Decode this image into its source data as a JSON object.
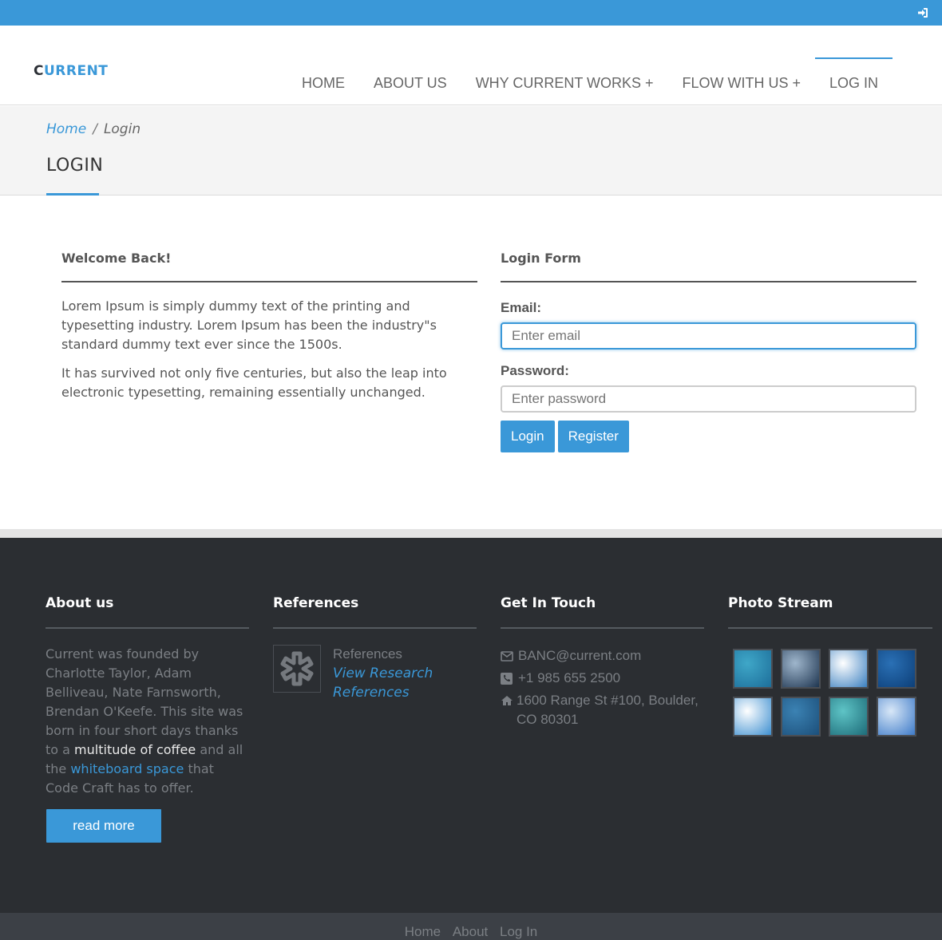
{
  "colors": {
    "accent": "#3a98d8",
    "footer_bg": "#2b2e32"
  },
  "topbar": {
    "icon": "sign-in-icon"
  },
  "brand": {
    "first_letter": "C",
    "rest": "URRENT"
  },
  "nav": {
    "home": "HOME",
    "about": "ABOUT US",
    "why": "WHY CURRENT WORKS +",
    "flow": "FLOW WITH US +",
    "login": "LOG IN"
  },
  "breadcrumb": {
    "home": "Home",
    "separator": "/",
    "current": "Login"
  },
  "page_title": "LOGIN",
  "welcome": {
    "heading": "Welcome Back!",
    "p1": "Lorem Ipsum is simply dummy text of the printing and typesetting industry. Lorem Ipsum has been the industry\"s standard dummy text ever since the 1500s.",
    "p2": "It has survived not only five centuries, but also the leap into electronic typesetting, remaining essentially unchanged."
  },
  "login_form": {
    "heading": "Login Form",
    "email_label": "Email:",
    "email_placeholder": "Enter email",
    "password_label": "Password:",
    "password_placeholder": "Enter password",
    "login_button": "Login",
    "register_button": "Register"
  },
  "footer": {
    "about": {
      "heading": "About us",
      "text_1": "Current was founded by Charlotte Taylor, Adam Belliveau, Nate Farnsworth, Brendan O'Keefe. This site was born in four short days thanks to a ",
      "highlight": "multitude of coffee",
      "text_2": " and all the ",
      "link": "whiteboard space",
      "text_3": " that Code Craft has to offer.",
      "read_more": "read more"
    },
    "references": {
      "heading": "References",
      "item_title": "References",
      "item_link": "View Research References"
    },
    "contact": {
      "heading": "Get In Touch",
      "email": "BANC@current.com",
      "phone": "+1 985 655 2500",
      "address": "1600 Range St #100, Boulder, CO 80301"
    },
    "photo_stream": {
      "heading": "Photo Stream",
      "photos": [
        {
          "color_a": "#3fa7c8",
          "color_b": "#1d6e9a"
        },
        {
          "color_a": "#9fb6cc",
          "color_b": "#1e3550"
        },
        {
          "color_a": "#ffffff",
          "color_b": "#3a7fc0"
        },
        {
          "color_a": "#2a70b5",
          "color_b": "#0d3f78"
        },
        {
          "color_a": "#ffffff",
          "color_b": "#3d8fd0"
        },
        {
          "color_a": "#3b82b3",
          "color_b": "#1c4f7a"
        },
        {
          "color_a": "#5ec4c6",
          "color_b": "#1d6b78"
        },
        {
          "color_a": "#d8e7f7",
          "color_b": "#3d7ac8"
        }
      ]
    }
  },
  "bottom_links": {
    "home": "Home",
    "about": "About",
    "login": "Log In"
  }
}
